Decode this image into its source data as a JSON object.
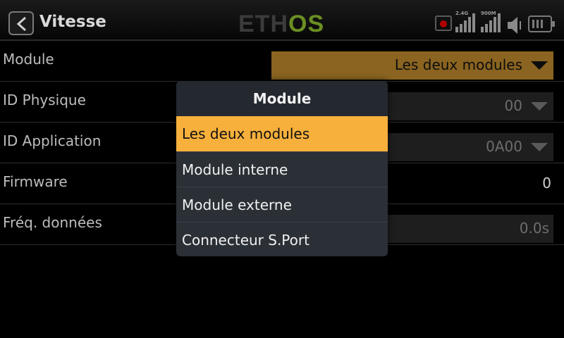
{
  "header": {
    "title": "Vitesse",
    "logo_left": "ETH",
    "logo_right": "OS",
    "signal_label_1": "2.4G",
    "signal_label_2": "900M"
  },
  "rows": [
    {
      "label": "Module",
      "value": "Les deux modules"
    },
    {
      "label": "ID Physique",
      "value": "00"
    },
    {
      "label": "ID Application",
      "value": "0A00"
    },
    {
      "label": "Firmware",
      "value": "0"
    },
    {
      "label": "Fréq. données",
      "value": "0.0s"
    }
  ],
  "popup": {
    "title": "Module",
    "options": [
      "Les deux modules",
      "Module interne",
      "Module externe",
      "Connecteur S.Port"
    ],
    "selected_index": 0
  },
  "colors": {
    "accent": "#f7b03c",
    "selected_field": "#8a6420",
    "logo_os": "#6b8e23",
    "record": "#b00000"
  },
  "icons": [
    "back-arrow-icon",
    "record-icon",
    "signal-bars-icon",
    "speaker-icon",
    "battery-icon",
    "dropdown-triangle-icon"
  ]
}
